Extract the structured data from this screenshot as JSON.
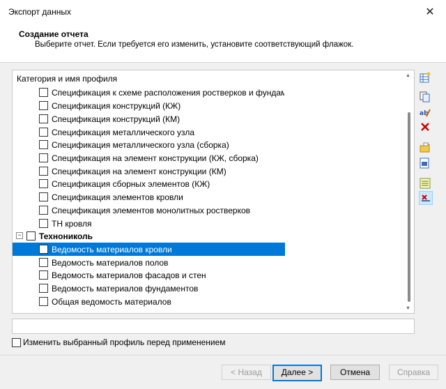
{
  "window": {
    "title": "Экспорт данных",
    "close_glyph": "✕"
  },
  "header": {
    "title": "Создание отчета",
    "subtitle": "Выберите отчет. Если требуется его изменить, установите соответствующий флажок."
  },
  "list": {
    "header": "Категория и имя профиля",
    "items": [
      {
        "label": "Спецификация к схеме расположения ростверков и фундаментов"
      },
      {
        "label": "Спецификация конструкций (КЖ)"
      },
      {
        "label": "Спецификация конструкций (КМ)"
      },
      {
        "label": "Спецификация металлического узла"
      },
      {
        "label": "Спецификация металлического узла (сборка)"
      },
      {
        "label": "Спецификация на элемент конструкции (КЖ, сборка)"
      },
      {
        "label": "Спецификация на элемент конструкции (КМ)"
      },
      {
        "label": "Спецификация сборных элементов (КЖ)"
      },
      {
        "label": "Спецификация элементов кровли"
      },
      {
        "label": "Спецификация элементов монолитных ростверков"
      },
      {
        "label": "ТН кровля"
      }
    ],
    "group": {
      "label": "Технониколь",
      "expander": "−"
    },
    "group_items": [
      {
        "label": "Ведомость материалов кровли",
        "selected": true
      },
      {
        "label": "Ведомость материалов полов"
      },
      {
        "label": "Ведомость материалов фасадов и стен"
      },
      {
        "label": "Ведомость материалов фундаментов"
      },
      {
        "label": "Общая ведомость материалов"
      }
    ]
  },
  "options": {
    "modify_profile": "Изменить выбранный профиль перед применением"
  },
  "buttons": {
    "back": "< Назад",
    "next": "Далее >",
    "cancel": "Отмена",
    "help": "Справка"
  },
  "toolbar": {
    "icons": [
      "new-profile-icon",
      "copy-profile-icon",
      "rename-profile-icon",
      "delete-profile-icon",
      "open-folder-icon",
      "export-profile-icon",
      "properties-icon",
      "filter-icon"
    ]
  },
  "colors": {
    "selection": "#0078d7",
    "delete": "#cc0000"
  }
}
